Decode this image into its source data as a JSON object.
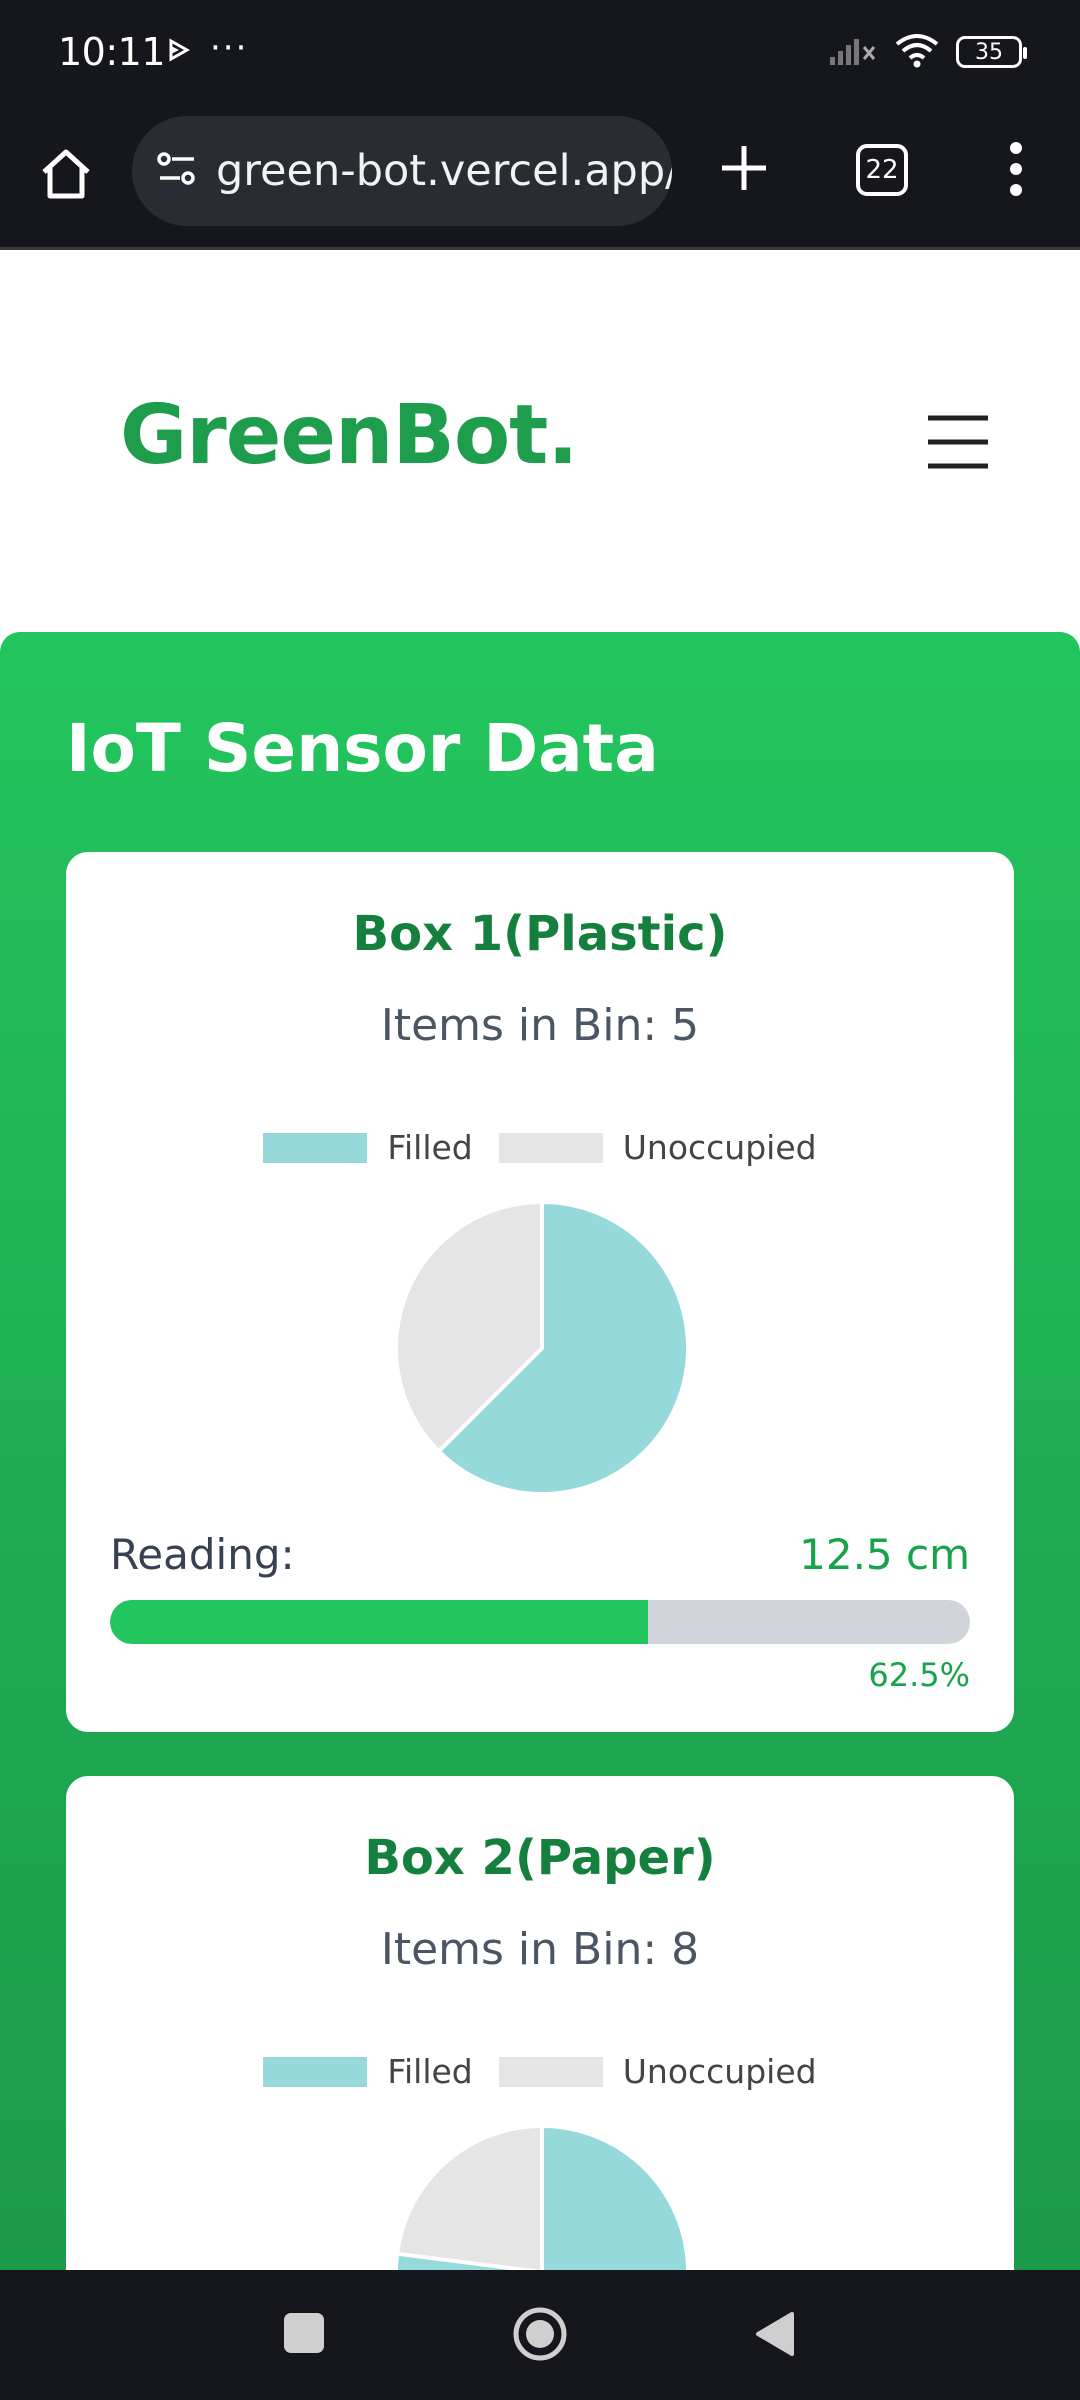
{
  "status_bar": {
    "time": "10:11",
    "more": "···",
    "battery": "35",
    "icons": [
      "play-icon",
      "signal-icon",
      "wifi-icon",
      "battery-icon"
    ]
  },
  "browser": {
    "url": "green-bot.vercel.app/",
    "tab_count": "22",
    "icons": [
      "home-icon",
      "site-settings-icon",
      "plus-icon",
      "more-vert-icon"
    ]
  },
  "site": {
    "logo": "GreenBot.",
    "menu_icon": "hamburger-icon"
  },
  "section": {
    "title": "IoT Sensor Data"
  },
  "colors": {
    "brand_green": "#22c55e",
    "brand_dark_green": "#15803d",
    "filled": "#95d9da",
    "unoccupied": "#e5e5e5",
    "progress_track": "#d1d5db"
  },
  "cards": [
    {
      "title": "Box 1(Plastic)",
      "items": "Items in Bin: 5",
      "legend_filled": "Filled",
      "legend_unoccupied": "Unoccupied",
      "reading_label": "Reading:",
      "reading_value": "12.5 cm",
      "progress_pct_text": "62.5%",
      "progress_fraction": 0.625
    },
    {
      "title": "Box 2(Paper)",
      "items": "Items in Bin: 8",
      "legend_filled": "Filled",
      "legend_unoccupied": "Unoccupied"
    }
  ],
  "chart_data": [
    {
      "type": "pie",
      "title": "",
      "categories": [
        "Filled",
        "Unoccupied"
      ],
      "values": [
        62.5,
        37.5
      ],
      "legend": "top"
    },
    {
      "type": "pie",
      "title": "",
      "categories": [
        "Filled",
        "Unoccupied"
      ],
      "values": [
        77,
        23
      ],
      "legend": "top"
    }
  ],
  "nav_bar": {
    "icons": [
      "recents-icon",
      "home-circle-icon",
      "back-icon"
    ]
  }
}
